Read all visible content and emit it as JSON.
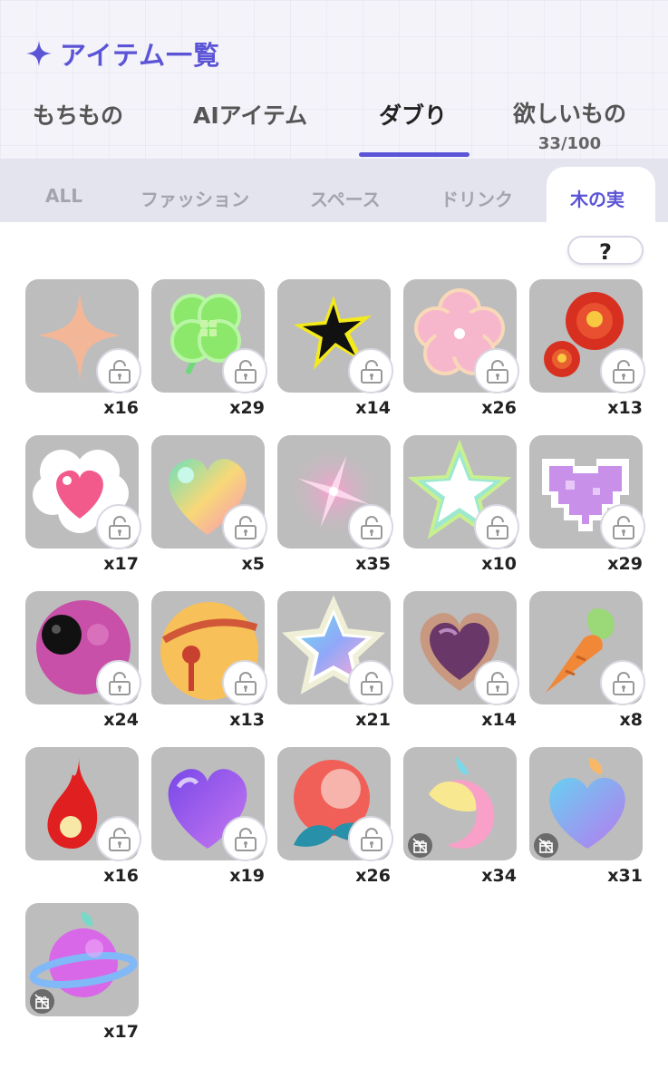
{
  "header": {
    "title": "アイテム一覧"
  },
  "tabs": [
    {
      "label": "もちもの",
      "sub": ""
    },
    {
      "label": "AIアイテム",
      "sub": ""
    },
    {
      "label": "ダブり",
      "sub": ""
    },
    {
      "label": "欲しいもの",
      "sub": "33/100"
    }
  ],
  "subtabs": [
    "ALL",
    "ファッション",
    "スペース",
    "ドリンク",
    "木の実"
  ],
  "help": {
    "label": "?"
  },
  "items": [
    {
      "icon": "peach-sparkle-icon",
      "count": "x16"
    },
    {
      "icon": "clover-icon",
      "count": "x29"
    },
    {
      "icon": "black-star-icon",
      "count": "x14"
    },
    {
      "icon": "pink-flower-icon",
      "count": "x26"
    },
    {
      "icon": "red-camellia-icon",
      "count": "x13"
    },
    {
      "icon": "cloud-heart-icon",
      "count": "x17"
    },
    {
      "icon": "rainbow-heart-icon",
      "count": "x5"
    },
    {
      "icon": "pink-twinkle-icon",
      "count": "x35"
    },
    {
      "icon": "white-star-icon",
      "count": "x10"
    },
    {
      "icon": "pixel-heart-icon",
      "count": "x29"
    },
    {
      "icon": "purple-eyeball-icon",
      "count": "x24"
    },
    {
      "icon": "bell-icon",
      "count": "x13"
    },
    {
      "icon": "gradient-star-icon",
      "count": "x21"
    },
    {
      "icon": "brown-heart-icon",
      "count": "x14"
    },
    {
      "icon": "carrot-icon",
      "count": "x8"
    },
    {
      "icon": "fire-icon",
      "count": "x16"
    },
    {
      "icon": "violet-heart-icon",
      "count": "x19"
    },
    {
      "icon": "peach-fruit-icon",
      "count": "x26"
    },
    {
      "icon": "moon-fruit-icon",
      "count": "x34"
    },
    {
      "icon": "heart-fruit-icon",
      "count": "x31"
    },
    {
      "icon": "planet-fruit-icon",
      "count": "x17"
    }
  ],
  "colors": {
    "accent": "#5b54d6",
    "card": "#bdbdbd"
  }
}
